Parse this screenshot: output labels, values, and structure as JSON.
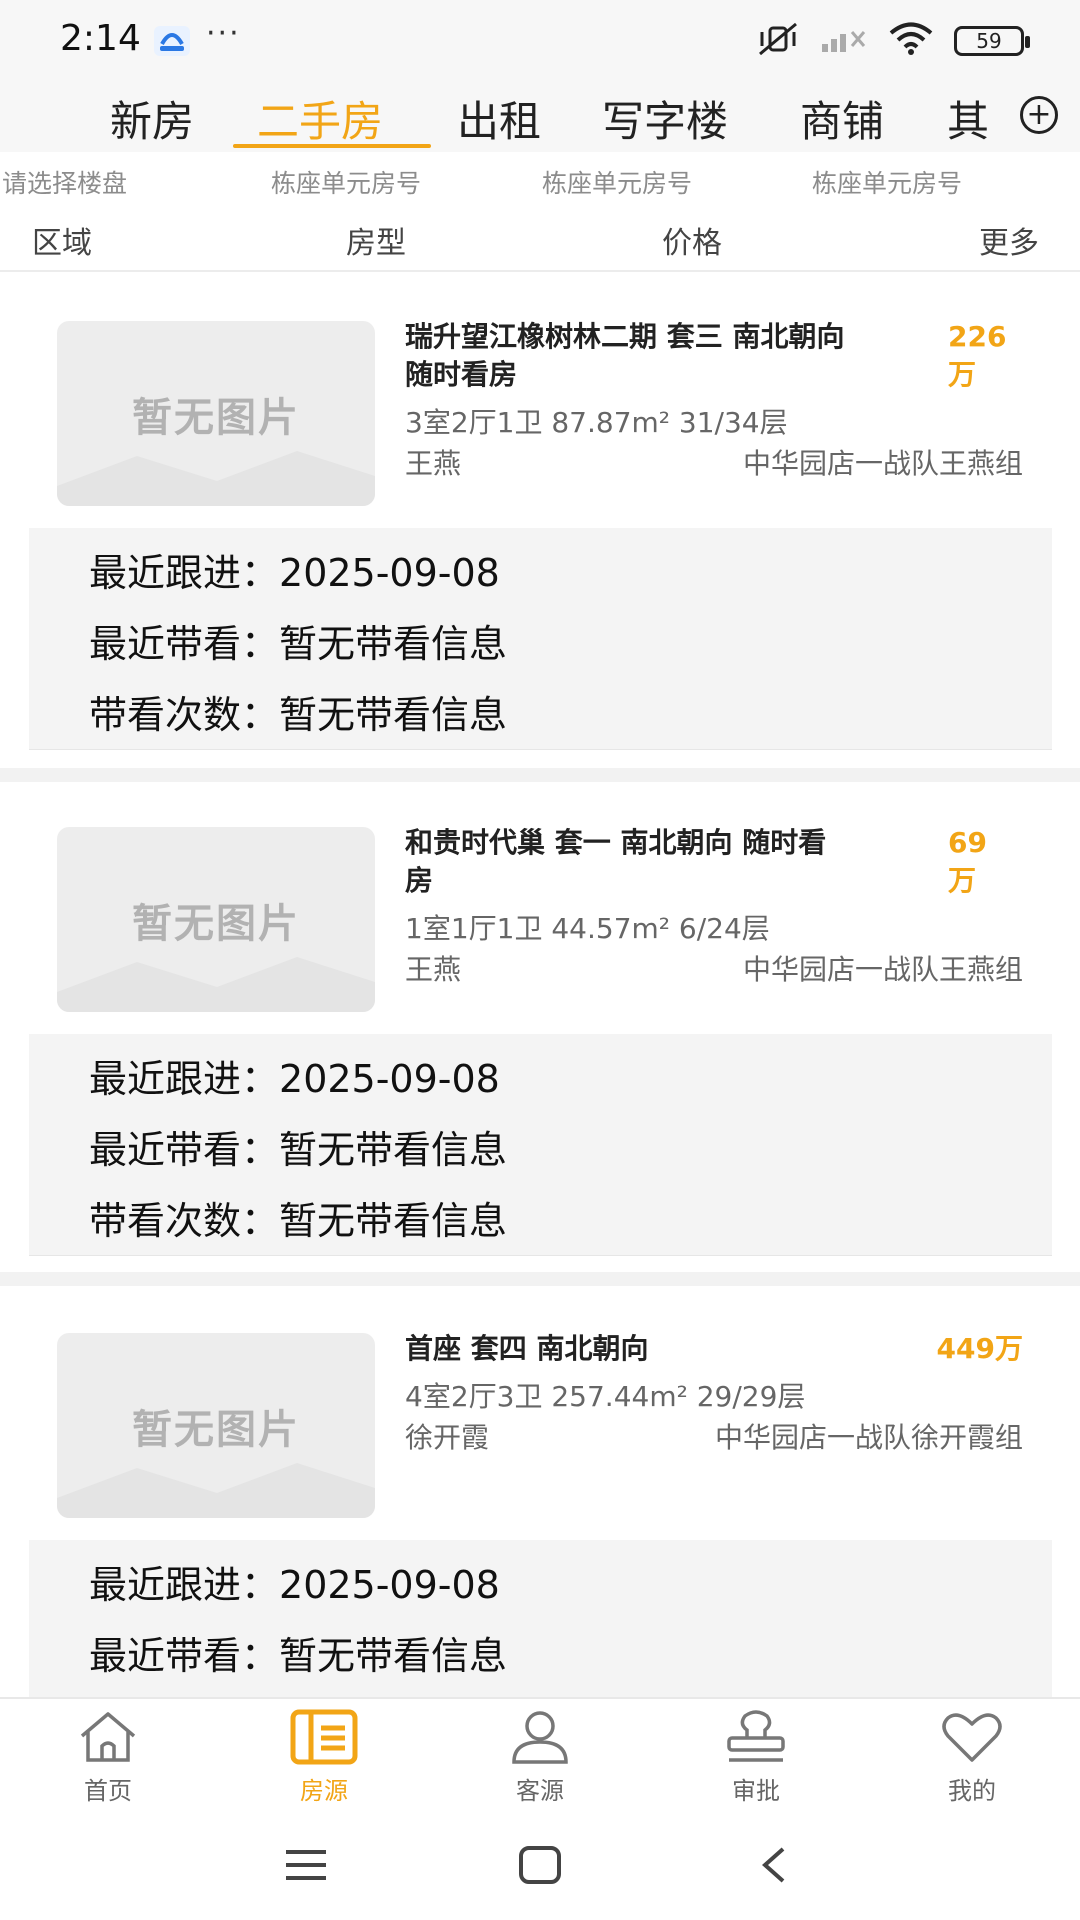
{
  "status_bar": {
    "time": "2:14",
    "dots": "···",
    "battery": "59"
  },
  "top_tabs": [
    "新房",
    "二手房",
    "出租",
    "写字楼",
    "商铺",
    "其"
  ],
  "active_tab": "二手房",
  "search": {
    "placeholders": [
      "请选择楼盘",
      "栋座单元房号",
      "栋座单元房号",
      "栋座单元房号"
    ]
  },
  "filters": [
    "区域",
    "房型",
    "价格",
    "更多"
  ],
  "thumb_placeholder": "暂无图片",
  "follow_labels": {
    "recent_follow": "最近跟进：",
    "recent_view": "最近带看：",
    "view_count": "带看次数："
  },
  "listings": [
    {
      "title_line1": "瑞升望江橡树林二期 套三 南北朝向",
      "title_line2": "随时看房",
      "price_line1": "226",
      "price_line2": "万",
      "spec": "3室2厅1卫 87.87m² 31/34层",
      "agent": "王燕",
      "team": "中华园店一战队王燕组",
      "recent_follow": "2025-09-08",
      "recent_view": "暂无带看信息",
      "view_count": "暂无带看信息"
    },
    {
      "title_line1": "和贵时代巢 套一 南北朝向 随时看",
      "title_line2": "房",
      "price_line1": "69",
      "price_line2": "万",
      "spec": "1室1厅1卫 44.57m² 6/24层",
      "agent": "王燕",
      "team": "中华园店一战队王燕组",
      "recent_follow": "2025-09-08",
      "recent_view": "暂无带看信息",
      "view_count": "暂无带看信息"
    },
    {
      "title_line1": "首座 套四 南北朝向",
      "price_line1": "449万",
      "spec": "4室2厅3卫 257.44m² 29/29层",
      "agent": "徐开霞",
      "team": "中华园店一战队徐开霞组",
      "recent_follow": "2025-09-08",
      "recent_view": "暂无带看信息"
    }
  ],
  "bottom_nav": [
    {
      "label": "首页",
      "icon": "home-icon"
    },
    {
      "label": "房源",
      "icon": "listing-icon"
    },
    {
      "label": "客源",
      "icon": "user-icon"
    },
    {
      "label": "审批",
      "icon": "stamp-icon"
    },
    {
      "label": "我的",
      "icon": "heart-icon"
    }
  ],
  "active_nav": "房源",
  "accent_color": "#f2a516"
}
